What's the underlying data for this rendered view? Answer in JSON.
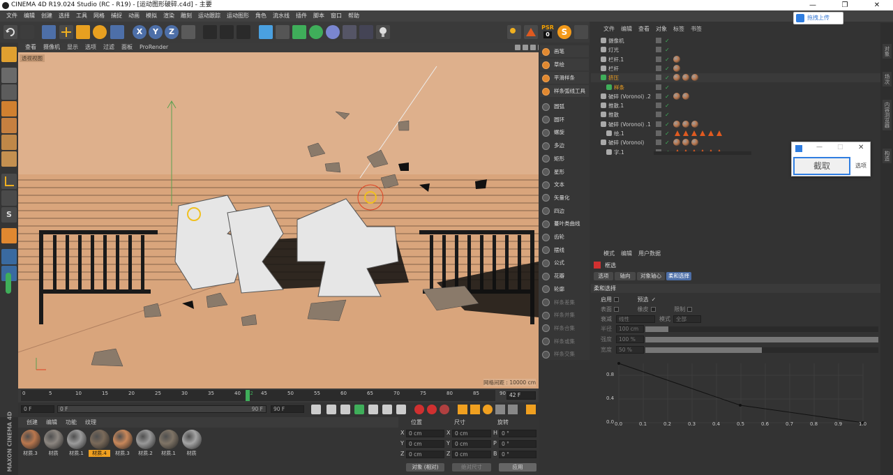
{
  "window": {
    "title": "CINEMA 4D R19.024 Studio (RC - R19) - [运动图形破碎.c4d] - 主要"
  },
  "menu": [
    "文件",
    "编辑",
    "创建",
    "选择",
    "工具",
    "网格",
    "捕捉",
    "动画",
    "模拟",
    "渲染",
    "雕刻",
    "运动跟踪",
    "运动图形",
    "角色",
    "流水线",
    "插件",
    "脚本",
    "窗口",
    "帮助"
  ],
  "toolbar": {
    "psr_label": "PSR",
    "psr_value": "0"
  },
  "viewport": {
    "menu": [
      "查看",
      "摄像机",
      "显示",
      "选项",
      "过滤",
      "面板",
      "ProRender"
    ],
    "label": "透视视图",
    "grid_info": "网格间距 : 10000 cm"
  },
  "right_tools": [
    "画笔",
    "草绘",
    "平滑样条",
    "样条弧线工具",
    "圆弧",
    "圆环",
    "螺旋",
    "多边",
    "矩形",
    "星形",
    "文本",
    "矢量化",
    "四边",
    "蔓叶类曲线",
    "齿轮",
    "摆线",
    "公式",
    "花瓣",
    "轮廓",
    "样条差集",
    "样条并集",
    "样条合集",
    "样条或集",
    "样条交集"
  ],
  "timeline": {
    "ticks": [
      "0",
      "5",
      "10",
      "15",
      "20",
      "25",
      "30",
      "35",
      "40",
      "42",
      "45",
      "50",
      "55",
      "60",
      "65",
      "70",
      "75",
      "80",
      "85",
      "90"
    ],
    "current_frame": "42 F"
  },
  "transport": {
    "start": "0 F",
    "min": "0 F",
    "max": "90 F",
    "end": "90 F"
  },
  "materials": {
    "menu": [
      "创建",
      "编辑",
      "功能",
      "纹理"
    ],
    "items": [
      {
        "label": "材质.3",
        "color": "#b9774e"
      },
      {
        "label": "材质",
        "color": "#8c8680"
      },
      {
        "label": "材质.1",
        "color": "#9b9b9b"
      },
      {
        "label": "材质.4",
        "color": "#7a6a5a",
        "selected": true
      },
      {
        "label": "材质.3",
        "color": "#c8875a"
      },
      {
        "label": "材质.2",
        "color": "#999999"
      },
      {
        "label": "材质.1",
        "color": "#7f7466"
      },
      {
        "label": "材质",
        "color": "#a5a5a5"
      }
    ],
    "brand": "MAXON CINEMA 4D"
  },
  "coords": {
    "headers": [
      "位置",
      "尺寸",
      "旋转"
    ],
    "rows": [
      {
        "axis": "X",
        "pos": "0 cm",
        "saxis": "X",
        "size": "0 cm",
        "raxis": "H",
        "rot": "0 °"
      },
      {
        "axis": "Y",
        "pos": "0 cm",
        "saxis": "Y",
        "size": "0 cm",
        "raxis": "P",
        "rot": "0 °"
      },
      {
        "axis": "Z",
        "pos": "0 cm",
        "saxis": "Z",
        "size": "0 cm",
        "raxis": "B",
        "rot": "0 °"
      }
    ],
    "mode": "对象 (相对)",
    "size_mode": "绝对尺寸",
    "apply": "应用"
  },
  "objects": {
    "menu": [
      "文件",
      "编辑",
      "查看",
      "对象",
      "标签",
      "书签"
    ],
    "upload": "拖拽上传",
    "items": [
      {
        "name": "摄像机",
        "indent": 0
      },
      {
        "name": "灯光",
        "indent": 0
      },
      {
        "name": "栏杆.1",
        "indent": 0
      },
      {
        "name": "栏杆",
        "indent": 0
      },
      {
        "name": "挤压",
        "indent": 0,
        "highlight": true
      },
      {
        "name": "样条",
        "indent": 1,
        "highlight": true
      },
      {
        "name": "破碎 (Voronoi) .2",
        "indent": 0
      },
      {
        "name": "推散.1",
        "indent": 0
      },
      {
        "name": "推散",
        "indent": 0
      },
      {
        "name": "破碎 (Voronoi) .1",
        "indent": 0
      },
      {
        "name": "绘.1",
        "indent": 1
      },
      {
        "name": "破碎 (Voronoi)",
        "indent": 0
      },
      {
        "name": "字.1",
        "indent": 1
      }
    ]
  },
  "snip": {
    "capture": "截取",
    "options": "选项"
  },
  "attributes": {
    "menu": [
      "模式",
      "编辑",
      "用户数据"
    ],
    "object": "框选",
    "tabs": [
      "选项",
      "轴向",
      "对象轴心",
      "柔和选择"
    ],
    "section": "柔和选择",
    "enable": "启用",
    "preview": "预选",
    "surface": "表面",
    "rubber": "橡皮",
    "restrict": "限制",
    "falloff_label": "衰减",
    "falloff": "线性",
    "mode_label": "模式",
    "mode": "全部",
    "radius_label": "半径",
    "radius": "100 cm",
    "strength_label": "强度",
    "strength": "100 %",
    "width_label": "宽度",
    "width": "50 %",
    "graph_y": [
      "0.8",
      "0.4",
      "0.0"
    ],
    "graph_x": [
      "0.0",
      "0.1",
      "0.2",
      "0.3",
      "0.4",
      "0.5",
      "0.6",
      "0.7",
      "0.8",
      "0.9",
      "1.0"
    ]
  },
  "side_tabs": [
    "对象",
    "场次",
    "内容浏览器",
    "构造"
  ]
}
